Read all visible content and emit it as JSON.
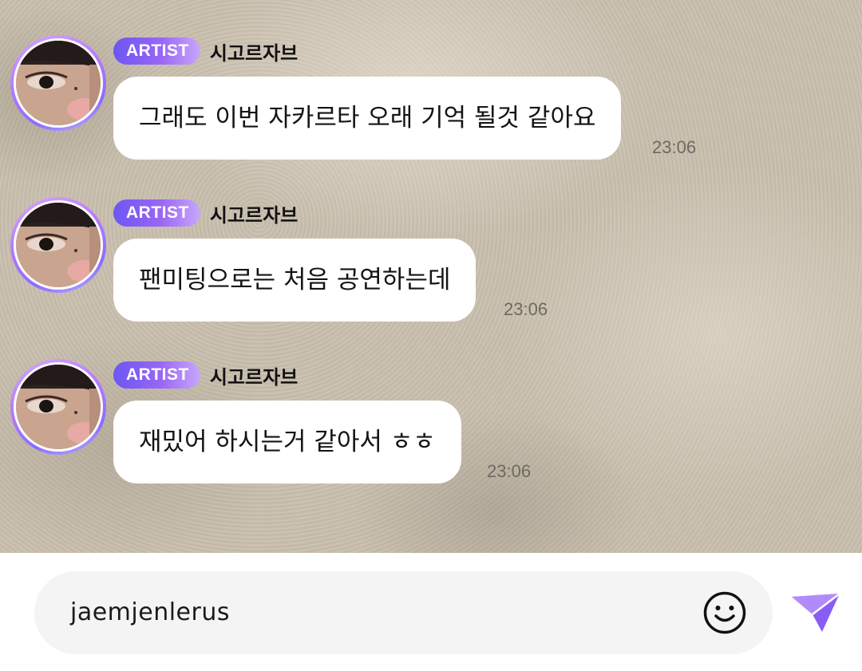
{
  "messages": [
    {
      "badge": "ARTIST",
      "sender": "시고르자브",
      "text": "그래도 이번 자카르타 오래 기억 될것 같아요",
      "time": "23:06"
    },
    {
      "badge": "ARTIST",
      "sender": "시고르자브",
      "text": "팬미팅으로는 처음 공연하는데",
      "time": "23:06"
    },
    {
      "badge": "ARTIST",
      "sender": "시고르자브",
      "text": "재밌어 하시는거 같아서 ㅎㅎ",
      "time": "23:06"
    }
  ],
  "composer": {
    "input_value": "jaemjenlerus",
    "emoji_icon": "smiley-icon",
    "send_icon": "paper-plane-send-icon"
  },
  "colors": {
    "badge_start": "#6c57f2",
    "badge_end": "#c8a7fb",
    "send_icon": "#8a5cf6",
    "bubble": "#ffffff"
  }
}
